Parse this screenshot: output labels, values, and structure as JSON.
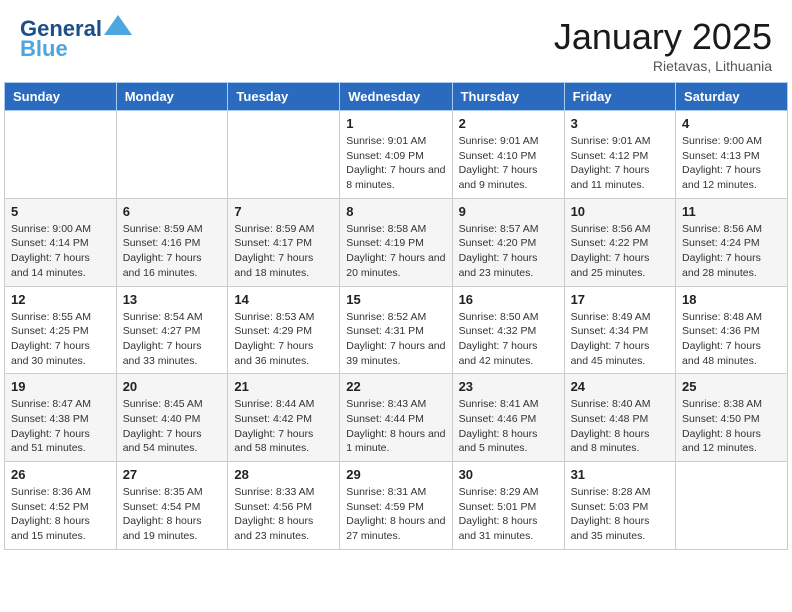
{
  "header": {
    "logo_line1": "General",
    "logo_line2": "Blue",
    "month": "January 2025",
    "location": "Rietavas, Lithuania"
  },
  "weekdays": [
    "Sunday",
    "Monday",
    "Tuesday",
    "Wednesday",
    "Thursday",
    "Friday",
    "Saturday"
  ],
  "weeks": [
    [
      {
        "day": "",
        "info": ""
      },
      {
        "day": "",
        "info": ""
      },
      {
        "day": "",
        "info": ""
      },
      {
        "day": "1",
        "info": "Sunrise: 9:01 AM\nSunset: 4:09 PM\nDaylight: 7 hours\nand 8 minutes."
      },
      {
        "day": "2",
        "info": "Sunrise: 9:01 AM\nSunset: 4:10 PM\nDaylight: 7 hours\nand 9 minutes."
      },
      {
        "day": "3",
        "info": "Sunrise: 9:01 AM\nSunset: 4:12 PM\nDaylight: 7 hours\nand 11 minutes."
      },
      {
        "day": "4",
        "info": "Sunrise: 9:00 AM\nSunset: 4:13 PM\nDaylight: 7 hours\nand 12 minutes."
      }
    ],
    [
      {
        "day": "5",
        "info": "Sunrise: 9:00 AM\nSunset: 4:14 PM\nDaylight: 7 hours\nand 14 minutes."
      },
      {
        "day": "6",
        "info": "Sunrise: 8:59 AM\nSunset: 4:16 PM\nDaylight: 7 hours\nand 16 minutes."
      },
      {
        "day": "7",
        "info": "Sunrise: 8:59 AM\nSunset: 4:17 PM\nDaylight: 7 hours\nand 18 minutes."
      },
      {
        "day": "8",
        "info": "Sunrise: 8:58 AM\nSunset: 4:19 PM\nDaylight: 7 hours\nand 20 minutes."
      },
      {
        "day": "9",
        "info": "Sunrise: 8:57 AM\nSunset: 4:20 PM\nDaylight: 7 hours\nand 23 minutes."
      },
      {
        "day": "10",
        "info": "Sunrise: 8:56 AM\nSunset: 4:22 PM\nDaylight: 7 hours\nand 25 minutes."
      },
      {
        "day": "11",
        "info": "Sunrise: 8:56 AM\nSunset: 4:24 PM\nDaylight: 7 hours\nand 28 minutes."
      }
    ],
    [
      {
        "day": "12",
        "info": "Sunrise: 8:55 AM\nSunset: 4:25 PM\nDaylight: 7 hours\nand 30 minutes."
      },
      {
        "day": "13",
        "info": "Sunrise: 8:54 AM\nSunset: 4:27 PM\nDaylight: 7 hours\nand 33 minutes."
      },
      {
        "day": "14",
        "info": "Sunrise: 8:53 AM\nSunset: 4:29 PM\nDaylight: 7 hours\nand 36 minutes."
      },
      {
        "day": "15",
        "info": "Sunrise: 8:52 AM\nSunset: 4:31 PM\nDaylight: 7 hours\nand 39 minutes."
      },
      {
        "day": "16",
        "info": "Sunrise: 8:50 AM\nSunset: 4:32 PM\nDaylight: 7 hours\nand 42 minutes."
      },
      {
        "day": "17",
        "info": "Sunrise: 8:49 AM\nSunset: 4:34 PM\nDaylight: 7 hours\nand 45 minutes."
      },
      {
        "day": "18",
        "info": "Sunrise: 8:48 AM\nSunset: 4:36 PM\nDaylight: 7 hours\nand 48 minutes."
      }
    ],
    [
      {
        "day": "19",
        "info": "Sunrise: 8:47 AM\nSunset: 4:38 PM\nDaylight: 7 hours\nand 51 minutes."
      },
      {
        "day": "20",
        "info": "Sunrise: 8:45 AM\nSunset: 4:40 PM\nDaylight: 7 hours\nand 54 minutes."
      },
      {
        "day": "21",
        "info": "Sunrise: 8:44 AM\nSunset: 4:42 PM\nDaylight: 7 hours\nand 58 minutes."
      },
      {
        "day": "22",
        "info": "Sunrise: 8:43 AM\nSunset: 4:44 PM\nDaylight: 8 hours\nand 1 minute."
      },
      {
        "day": "23",
        "info": "Sunrise: 8:41 AM\nSunset: 4:46 PM\nDaylight: 8 hours\nand 5 minutes."
      },
      {
        "day": "24",
        "info": "Sunrise: 8:40 AM\nSunset: 4:48 PM\nDaylight: 8 hours\nand 8 minutes."
      },
      {
        "day": "25",
        "info": "Sunrise: 8:38 AM\nSunset: 4:50 PM\nDaylight: 8 hours\nand 12 minutes."
      }
    ],
    [
      {
        "day": "26",
        "info": "Sunrise: 8:36 AM\nSunset: 4:52 PM\nDaylight: 8 hours\nand 15 minutes."
      },
      {
        "day": "27",
        "info": "Sunrise: 8:35 AM\nSunset: 4:54 PM\nDaylight: 8 hours\nand 19 minutes."
      },
      {
        "day": "28",
        "info": "Sunrise: 8:33 AM\nSunset: 4:56 PM\nDaylight: 8 hours\nand 23 minutes."
      },
      {
        "day": "29",
        "info": "Sunrise: 8:31 AM\nSunset: 4:59 PM\nDaylight: 8 hours\nand 27 minutes."
      },
      {
        "day": "30",
        "info": "Sunrise: 8:29 AM\nSunset: 5:01 PM\nDaylight: 8 hours\nand 31 minutes."
      },
      {
        "day": "31",
        "info": "Sunrise: 8:28 AM\nSunset: 5:03 PM\nDaylight: 8 hours\nand 35 minutes."
      },
      {
        "day": "",
        "info": ""
      }
    ]
  ]
}
